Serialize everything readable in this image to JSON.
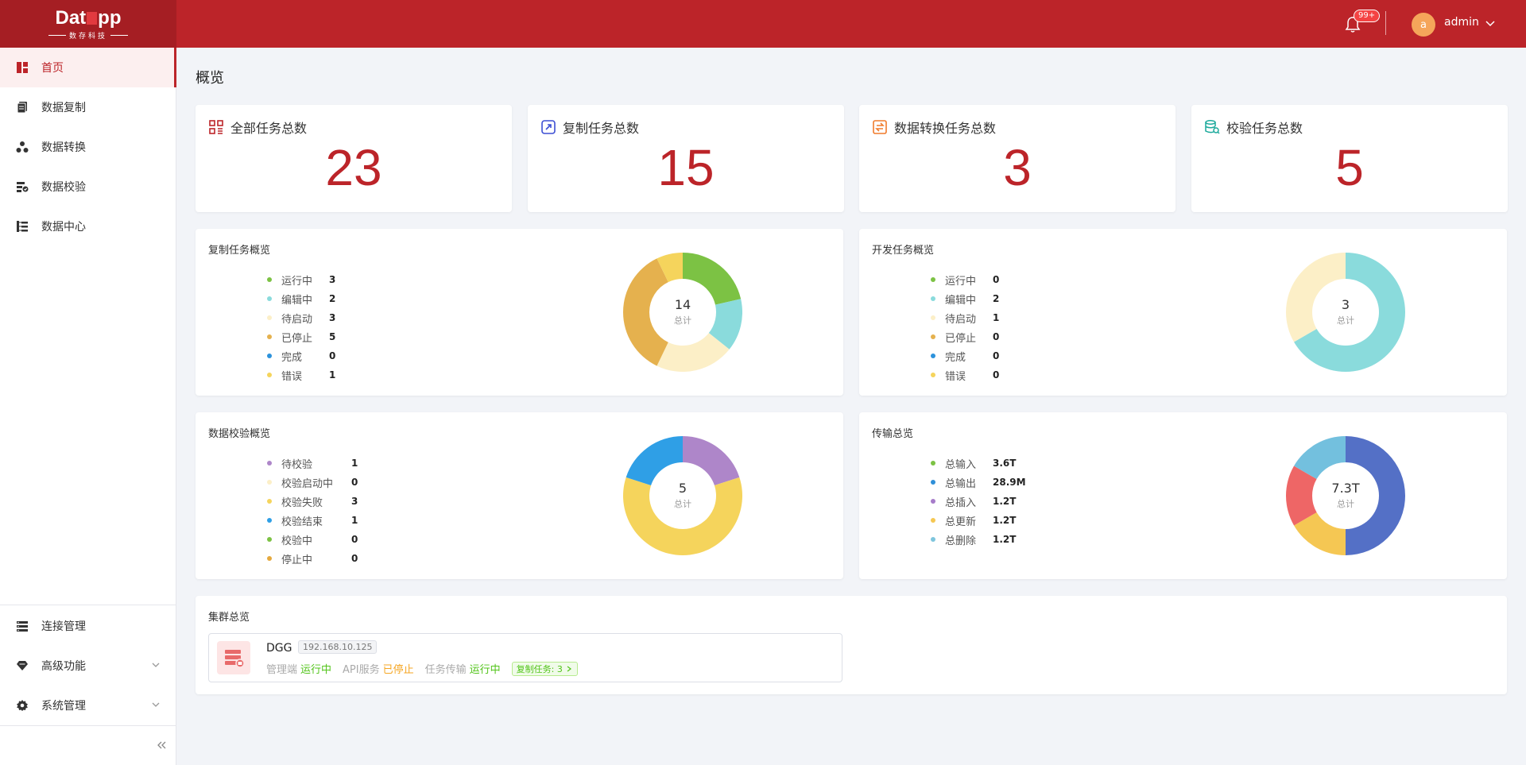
{
  "header": {
    "logo_main_left": "Dat",
    "logo_main_right": "pp",
    "logo_sub": "数存科技",
    "notification_badge": "99+",
    "avatar_letter": "a",
    "username": "admin"
  },
  "sidebar": {
    "items": [
      {
        "label": "首页",
        "icon": "dashboard-icon",
        "active": true
      },
      {
        "label": "数据复制",
        "icon": "copy-icon"
      },
      {
        "label": "数据转换",
        "icon": "transform-icon"
      },
      {
        "label": "数据校验",
        "icon": "verify-icon"
      },
      {
        "label": "数据中心",
        "icon": "tree-icon"
      }
    ],
    "bottom_items": [
      {
        "label": "连接管理",
        "icon": "list-icon"
      },
      {
        "label": "高级功能",
        "icon": "diamond-icon"
      },
      {
        "label": "系统管理",
        "icon": "gear-icon"
      }
    ]
  },
  "page": {
    "title": "概览"
  },
  "stats": [
    {
      "label": "全部任务总数",
      "value": "23",
      "icon": "grid-icon",
      "color": "#bc2429"
    },
    {
      "label": "复制任务总数",
      "value": "15",
      "icon": "link-icon",
      "color": "#3d4fd4"
    },
    {
      "label": "数据转换任务总数",
      "value": "3",
      "icon": "swap-icon",
      "color": "#f07b2c"
    },
    {
      "label": "校验任务总数",
      "value": "5",
      "icon": "database-check-icon",
      "color": "#1aa99b"
    }
  ],
  "panels": {
    "copy": {
      "title": "复制任务概览",
      "total": "14",
      "total_label": "总计",
      "items": [
        {
          "label": "运行中",
          "value": "3",
          "color": "#7cc244"
        },
        {
          "label": "编辑中",
          "value": "2",
          "color": "#8adbdc"
        },
        {
          "label": "待启动",
          "value": "3",
          "color": "#fcefc7"
        },
        {
          "label": "已停止",
          "value": "5",
          "color": "#e5b14e"
        },
        {
          "label": "完成",
          "value": "0",
          "color": "#2c92dc"
        },
        {
          "label": "错误",
          "value": "1",
          "color": "#f5d45c"
        }
      ]
    },
    "dev": {
      "title": "开发任务概览",
      "total": "3",
      "total_label": "总计",
      "items": [
        {
          "label": "运行中",
          "value": "0",
          "color": "#7cc244"
        },
        {
          "label": "编辑中",
          "value": "2",
          "color": "#8adbdc"
        },
        {
          "label": "待启动",
          "value": "1",
          "color": "#fcefc7"
        },
        {
          "label": "已停止",
          "value": "0",
          "color": "#e5b14e"
        },
        {
          "label": "完成",
          "value": "0",
          "color": "#2c92dc"
        },
        {
          "label": "错误",
          "value": "0",
          "color": "#f5d45c"
        }
      ]
    },
    "verify": {
      "title": "数据校验概览",
      "total": "5",
      "total_label": "总计",
      "items": [
        {
          "label": "待校验",
          "value": "1",
          "color": "#ae86c9"
        },
        {
          "label": "校验启动中",
          "value": "0",
          "color": "#fcefc7"
        },
        {
          "label": "校验失败",
          "value": "3",
          "color": "#f5d45c"
        },
        {
          "label": "校验结束",
          "value": "1",
          "color": "#2f9fe6"
        },
        {
          "label": "校验中",
          "value": "0",
          "color": "#7cc244"
        },
        {
          "label": "停止中",
          "value": "0",
          "color": "#e5a93e"
        }
      ]
    },
    "transfer": {
      "title": "传输总览",
      "total": "7.3T",
      "total_label": "总计",
      "items": [
        {
          "label": "总输入",
          "value": "3.6T",
          "color": "#7cc244",
          "amount": 3.6
        },
        {
          "label": "总输出",
          "value": "28.9M",
          "color": "#2f8fd8",
          "amount": 0.0
        },
        {
          "label": "总插入",
          "value": "1.2T",
          "color": "#a67bc9",
          "amount": 1.2
        },
        {
          "label": "总更新",
          "value": "1.2T",
          "color": "#f5c753",
          "amount": 1.2
        },
        {
          "label": "总删除",
          "value": "1.2T",
          "color": "#7ec5dd",
          "amount": 1.2
        }
      ]
    }
  },
  "donut_colors": {
    "transfer": [
      "#5470c6",
      "#f5c753",
      "#ee6666",
      "#73c0de"
    ]
  },
  "cluster": {
    "title": "集群总览",
    "name": "DGG",
    "ip": "192.168.10.125",
    "mgmt_label": "管理端",
    "mgmt_status": "运行中",
    "api_label": "API服务",
    "api_status": "已停止",
    "transfer_label": "任务传输",
    "transfer_status": "运行中",
    "task_tag": "复制任务: 3"
  }
}
